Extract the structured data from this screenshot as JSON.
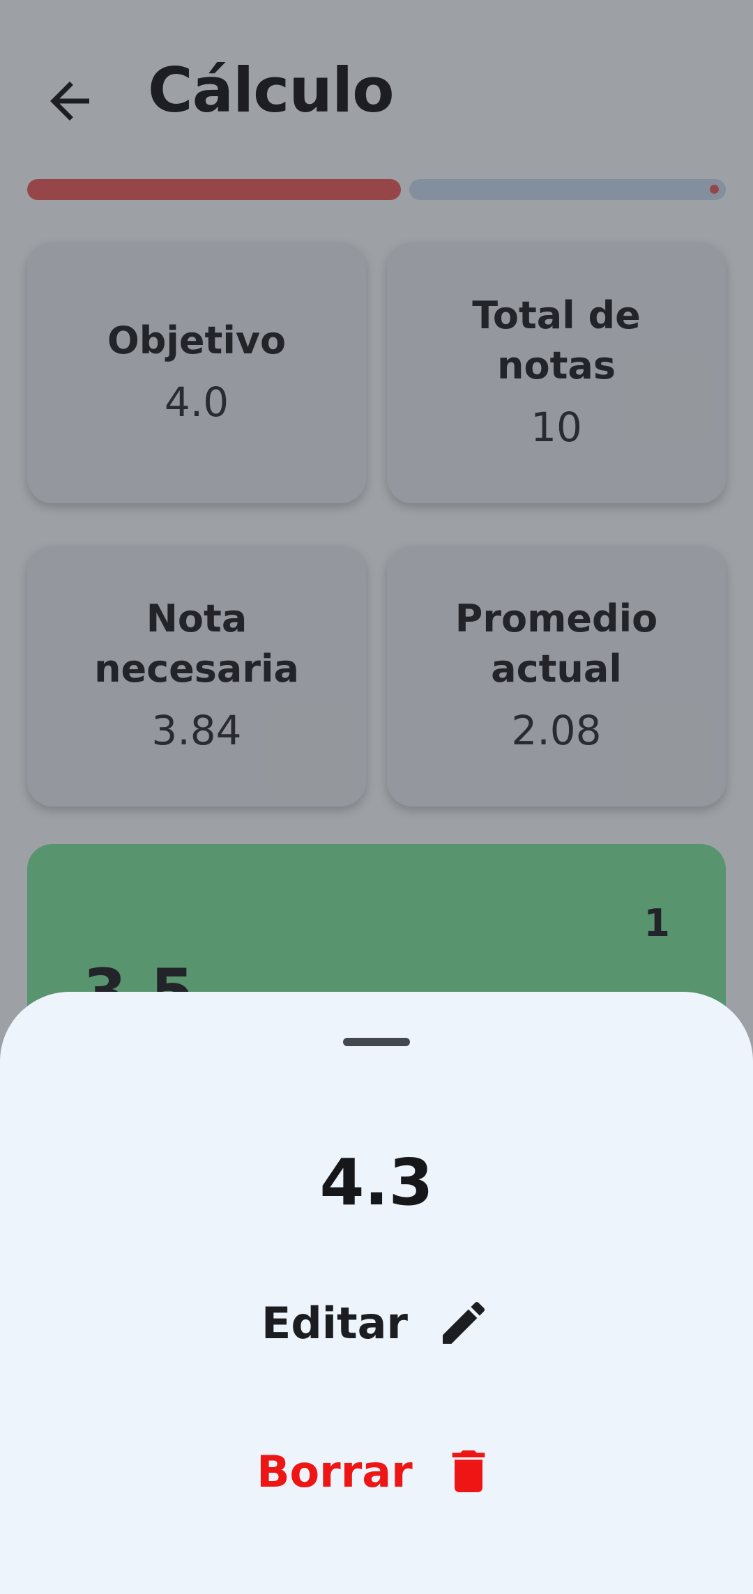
{
  "app_bar": {
    "title": "Cálculo",
    "back_icon": "arrow-left-icon"
  },
  "progress": {
    "filled_color": "#e55b5b",
    "remaining_color": "#c6d7ec",
    "filled_fraction": 0.54
  },
  "stats": {
    "objetivo": {
      "label": "Objetivo",
      "value": "4.0"
    },
    "total_notas": {
      "label": "Total de notas",
      "value": "10"
    },
    "nota_necesaria": {
      "label": "Nota necesaria",
      "value": "3.84"
    },
    "promedio_actual": {
      "label": "Promedio actual",
      "value": "2.08"
    }
  },
  "grade_list": [
    {
      "index": "1",
      "value": "3.5",
      "color": "#7ae098"
    }
  ],
  "bottom_sheet": {
    "grade": "4.3",
    "edit_label": "Editar",
    "edit_icon": "pencil-icon",
    "delete_label": "Borrar",
    "delete_icon": "trash-icon",
    "delete_color": "#ee1515"
  }
}
